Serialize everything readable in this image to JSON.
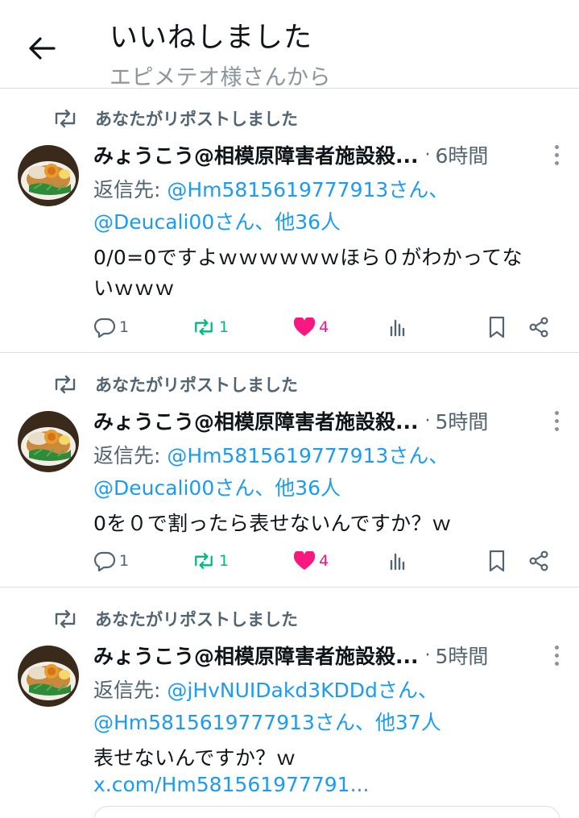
{
  "header": {
    "title": "いいねしました",
    "subtitle": "エピメテオ様さんから"
  },
  "posts": [
    {
      "repost_label": "あなたがリポストしました",
      "author": "みょうこう@相模原障害者施設殺...",
      "dot": "·",
      "time": "6時間",
      "reply_prefix": "返信先: ",
      "reply_line1_mention": "@Hm5815619777913さん、",
      "reply_line2_mention": "@Deucali00さん、他36人",
      "body_line1": "0/0=0ですよｗｗｗｗｗｗほら０がわかってな",
      "body_line2": "いｗｗｗ",
      "replies": "1",
      "reposts": "1",
      "likes": "4"
    },
    {
      "repost_label": "あなたがリポストしました",
      "author": "みょうこう@相模原障害者施設殺...",
      "dot": "·",
      "time": "5時間",
      "reply_prefix": "返信先: ",
      "reply_line1_mention": "@Hm5815619777913さん、",
      "reply_line2_mention": "@Deucali00さん、他36人",
      "body_line1": "0を０で割ったら表せないんですか？ｗ",
      "replies": "1",
      "reposts": "1",
      "likes": "4"
    },
    {
      "repost_label": "あなたがリポストしました",
      "author": "みょうこう@相模原障害者施設殺...",
      "dot": "·",
      "time": "5時間",
      "reply_prefix": "返信先: ",
      "reply_line1_mention": "@jHvNUIDakd3KDDdさん、",
      "reply_line2_mention": "@Hm5815619777913さん、他37人",
      "body_line1": "表せないんですか？ｗ",
      "link": "x.com/Hm581561977791..."
    }
  ],
  "colors": {
    "accent": "#1d9bf0",
    "repost_green": "#00ba7c",
    "like_pink": "#f91880",
    "secondary_text": "#536471"
  },
  "icons": [
    "back-arrow-icon",
    "repost-icon",
    "more-dots-icon",
    "reply-icon",
    "like-heart-icon",
    "views-icon",
    "bookmark-icon",
    "share-icon"
  ]
}
